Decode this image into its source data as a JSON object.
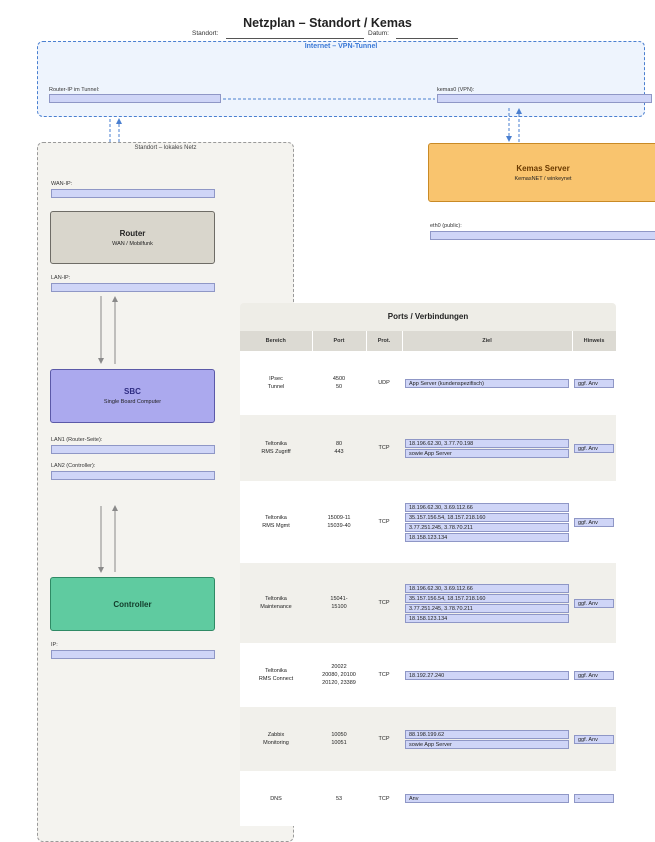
{
  "header": {
    "title": "Netzplan – Standort / Kemas",
    "standort_label": "Standort:",
    "datum_label": "Datum:"
  },
  "internet": {
    "title": "Internet – VPN-Tunnel",
    "router_ip_label": "Router-IP im Tunnel:",
    "kemas0_label": "kemas0 (VPN):"
  },
  "site": {
    "title": "Standort – lokales Netz",
    "wan_ip_label": "WAN-IP:",
    "lan_ip_label": "LAN-IP:",
    "lan1_label": "LAN1 (Router-Seite):",
    "lan2_label": "LAN2 (Controller):",
    "ip_label": "IP:"
  },
  "router": {
    "title": "Router",
    "subtitle": "WAN / Mobilfunk"
  },
  "sbc": {
    "title": "SBC",
    "subtitle": "Single Board Computer"
  },
  "controller": {
    "title": "Controller"
  },
  "server": {
    "title": "Kemas Server",
    "subtitle": "KemasNET / winkeynet",
    "eth0_label": "eth0 (public):"
  },
  "ports": {
    "title": "Ports / Verbindungen",
    "headers": [
      "Bereich",
      "Port",
      "Prot.",
      "Ziel",
      "Hinweis"
    ],
    "rows": [
      {
        "bereich": [
          "IPsec",
          "Tunnel"
        ],
        "port": [
          "4500",
          "50"
        ],
        "prot": "UDP",
        "ziel": [
          "App Server (kundenspezifisch)"
        ],
        "hinweis": "ggf. Anv"
      },
      {
        "bereich": [
          "Teltonika",
          "RMS Zugriff"
        ],
        "port": [
          "80",
          "443"
        ],
        "prot": "TCP",
        "ziel": [
          "18.196.62.30, 3.77.70.198",
          "sowie App Server"
        ],
        "hinweis": "ggf. Anv"
      },
      {
        "bereich": [
          "Teltonika",
          "RMS Mgmt"
        ],
        "port": [
          "15009-11",
          "15039-40"
        ],
        "prot": "TCP",
        "ziel": [
          "18.196.62.30, 3.69.112.66",
          "35.157.156.54, 18.157.218.160",
          "3.77.251.245, 3.78.70.211",
          "18.158.123.134"
        ],
        "hinweis": "ggf. Anv"
      },
      {
        "bereich": [
          "Teltonika",
          "Maintenance"
        ],
        "port": [
          "15041-",
          "15100"
        ],
        "prot": "TCP",
        "ziel": [
          "18.196.62.30, 3.69.112.66",
          "35.157.156.54, 18.157.218.160",
          "3.77.251.245, 3.78.70.211",
          "18.158.123.134"
        ],
        "hinweis": "ggf. Anv"
      },
      {
        "bereich": [
          "Teltonika",
          "RMS Connect"
        ],
        "port": [
          "20022",
          "20080, 20100",
          "20120, 23389"
        ],
        "prot": "TCP",
        "ziel": [
          "18.192.27.240"
        ],
        "hinweis": "ggf. Anv"
      },
      {
        "bereich": [
          "Zabbix",
          "Monitoring"
        ],
        "port": [
          "10050",
          "10051"
        ],
        "prot": "TCP",
        "ziel": [
          "88.198.199.62",
          "sowie App Server"
        ],
        "hinweis": "ggf. Anv"
      },
      {
        "bereich": [
          "DNS"
        ],
        "port": [
          "53"
        ],
        "prot": "TCP",
        "ziel": [
          "Anv"
        ],
        "hinweis": "-"
      }
    ]
  },
  "colors": {
    "vpn_border": "#4a7fd0",
    "vpn_fill": "#eef4fd",
    "router_fill": "#d9d6cc",
    "sbc_fill": "#aba9ee",
    "controller_fill": "#5fcba0",
    "server_fill": "#f9c46e",
    "field_fill": "#cfd5f7"
  }
}
